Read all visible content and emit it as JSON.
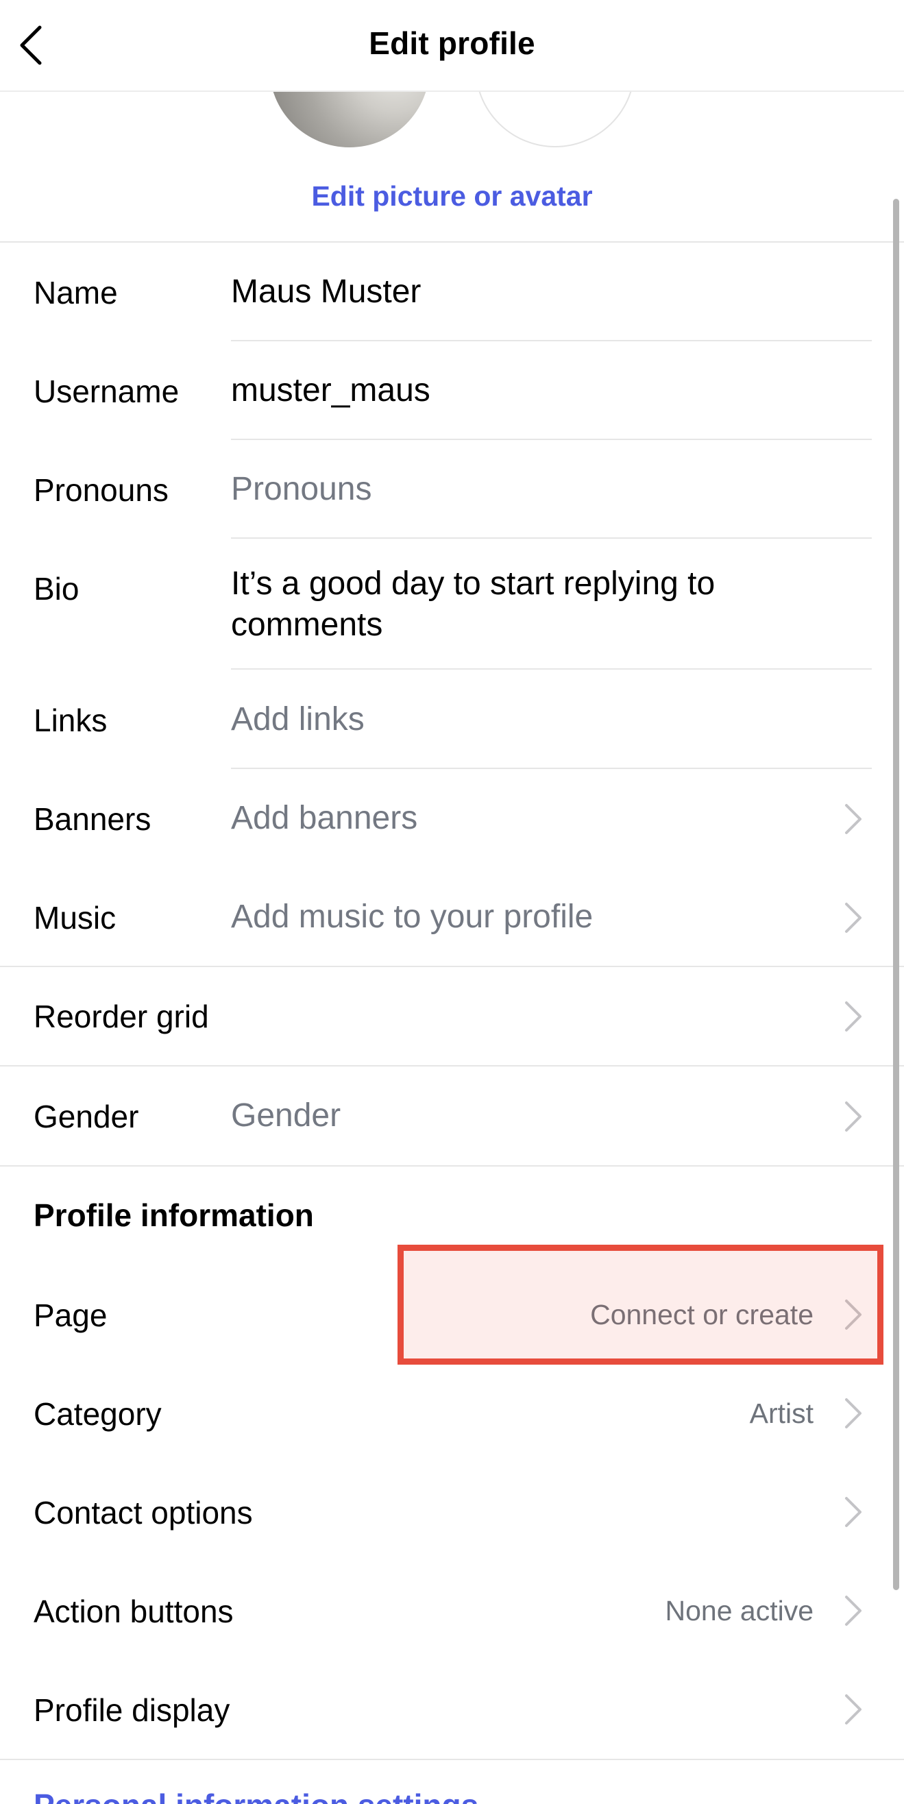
{
  "header": {
    "title": "Edit profile"
  },
  "edit_picture_label": "Edit picture or avatar",
  "fields": {
    "name": {
      "label": "Name",
      "value": "Maus Muster"
    },
    "username": {
      "label": "Username",
      "value": "muster_maus"
    },
    "pronouns": {
      "label": "Pronouns",
      "placeholder": "Pronouns"
    },
    "bio": {
      "label": "Bio",
      "value": "It’s a good day to start replying to comments"
    },
    "links": {
      "label": "Links",
      "placeholder": "Add links"
    },
    "banners": {
      "label": "Banners",
      "placeholder": "Add banners"
    },
    "music": {
      "label": "Music",
      "placeholder": "Add music to your profile"
    }
  },
  "reorder_grid": {
    "label": "Reorder grid"
  },
  "gender": {
    "label": "Gender",
    "placeholder": "Gender"
  },
  "profile_information": {
    "title": "Profile information",
    "page": {
      "label": "Page",
      "value": "Connect or create"
    },
    "category": {
      "label": "Category",
      "value": "Artist"
    },
    "contact_options": {
      "label": "Contact options"
    },
    "action_buttons": {
      "label": "Action buttons",
      "value": "None active"
    },
    "profile_display": {
      "label": "Profile display"
    }
  },
  "personal_info_link": "Personal information settings",
  "colors": {
    "accent": "#4b5ce1",
    "highlight_border": "#e74c3c"
  },
  "icons": {
    "back": "chevron-left-icon",
    "row_chevron": "chevron-right-icon"
  }
}
